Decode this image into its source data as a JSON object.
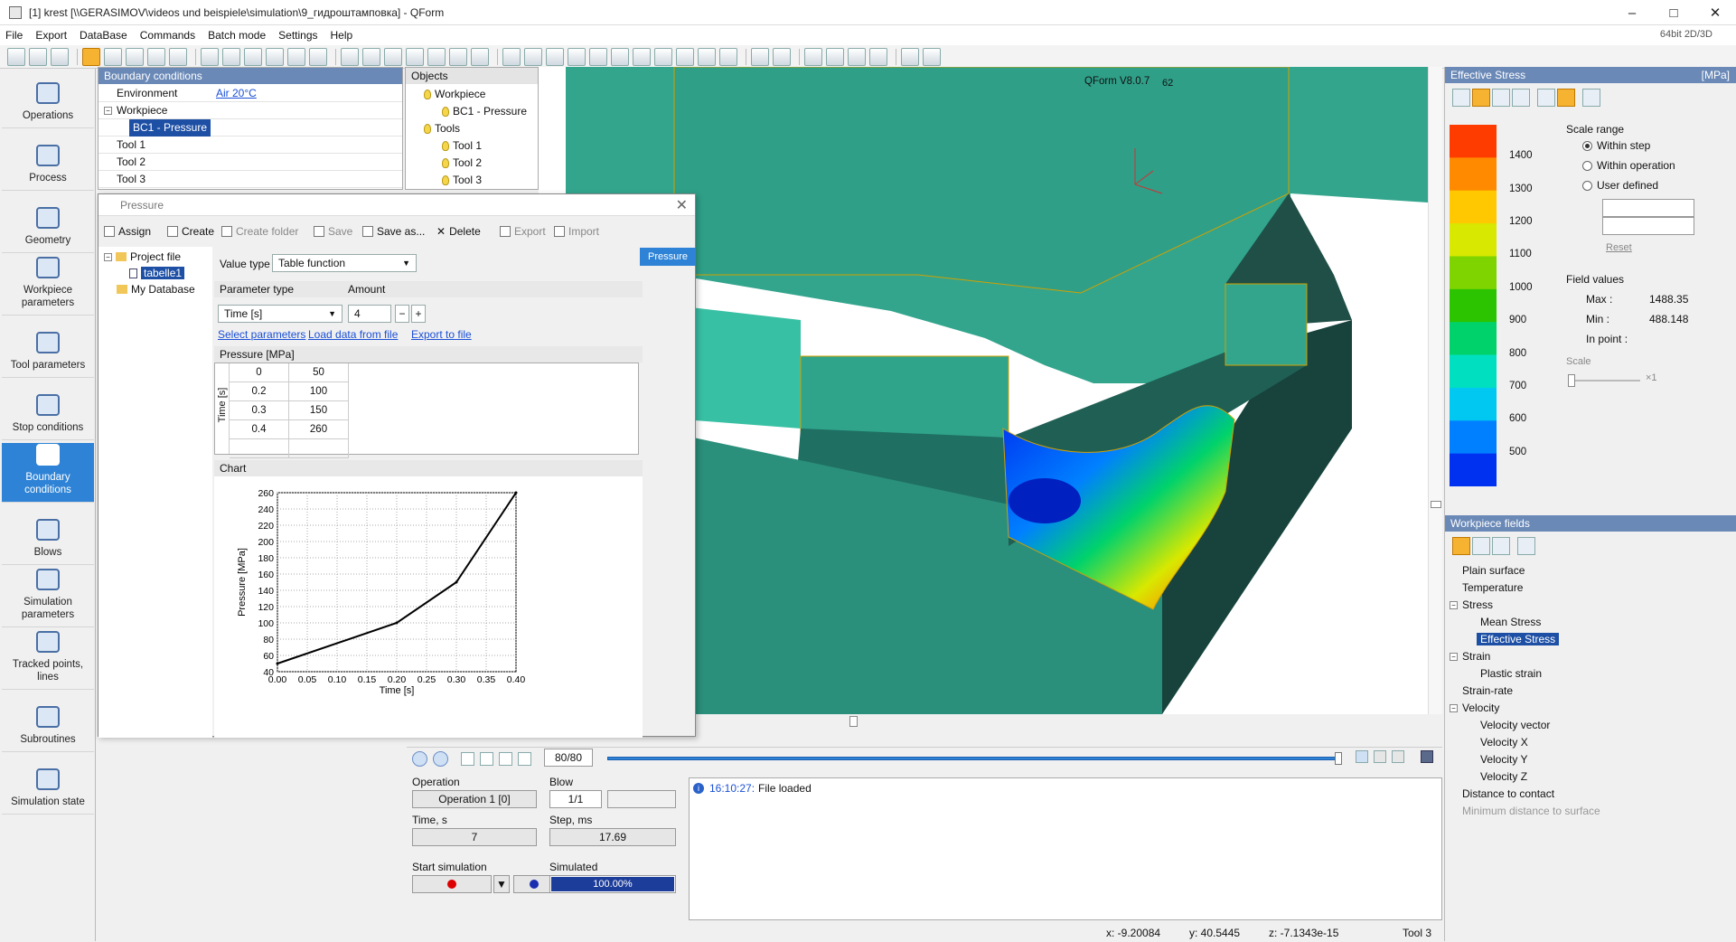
{
  "window": {
    "title": "[1] krest  [\\\\GERASIMOV\\videos und beispiele\\simulation\\9_гидроштамповка] - QForm",
    "bits": "64bit 2D/3D"
  },
  "menu": [
    "File",
    "Export",
    "DataBase",
    "Commands",
    "Batch mode",
    "Settings",
    "Help"
  ],
  "nav": [
    {
      "label": "Operations"
    },
    {
      "label": "Process"
    },
    {
      "label": "Geometry"
    },
    {
      "label": "Workpiece parameters"
    },
    {
      "label": "Tool parameters"
    },
    {
      "label": "Stop conditions"
    },
    {
      "label": "Boundary conditions",
      "active": true
    },
    {
      "label": "Blows"
    },
    {
      "label": "Simulation parameters"
    },
    {
      "label": "Tracked points, lines"
    },
    {
      "label": "Subroutines"
    },
    {
      "label": "Simulation state"
    }
  ],
  "bc": {
    "header": "Boundary conditions",
    "rows": [
      {
        "label": "Environment",
        "value": "Air 20°C"
      },
      {
        "label": "Workpiece",
        "value": ""
      },
      {
        "label": "BC1 - Pressure",
        "value": ""
      },
      {
        "label": "Tool 1",
        "value": ""
      },
      {
        "label": "Tool 2",
        "value": ""
      },
      {
        "label": "Tool 3",
        "value": ""
      }
    ]
  },
  "objects": {
    "header": "Objects",
    "items": [
      "Workpiece",
      "BC1 - Pressure",
      "Tools",
      "Tool 1",
      "Tool 2",
      "Tool 3"
    ]
  },
  "viewport": {
    "version": "QForm V8.0.7",
    "counter": "62"
  },
  "dialog": {
    "title": "Pressure",
    "toolbar": {
      "assign": "Assign",
      "create": "Create",
      "create_folder": "Create folder",
      "save": "Save",
      "save_as": "Save as...",
      "delete": "Delete",
      "export": "Export",
      "import": "Import"
    },
    "tree": {
      "project": "Project file",
      "item": "tabelle1",
      "db": "My Database"
    },
    "value_type_label": "Value type",
    "value_type": "Table function",
    "param_type_label": "Parameter type",
    "amount_label": "Amount",
    "param_type": "Time [s]",
    "amount": "4",
    "links": {
      "select": "Select parameters",
      "load": "Load data from file",
      "export": "Export to file"
    },
    "pressure_section": "Pressure [MPa]",
    "time_axis": "Time [s]",
    "table": [
      {
        "t": "0",
        "p": "50"
      },
      {
        "t": "0.2",
        "p": "100"
      },
      {
        "t": "0.3",
        "p": "150"
      },
      {
        "t": "0.4",
        "p": "260"
      }
    ],
    "chart_section": "Chart",
    "tab": "Pressure"
  },
  "chart_data": {
    "type": "line",
    "x": [
      0,
      0.2,
      0.3,
      0.4
    ],
    "series": [
      {
        "values": [
          50,
          100,
          150,
          260
        ]
      }
    ],
    "xlabel": "Time [s]",
    "ylabel": "Pressure [MPa]",
    "xlim": [
      0,
      0.4
    ],
    "ylim": [
      40,
      260
    ],
    "xticks": [
      "0.00",
      "0.05",
      "0.10",
      "0.15",
      "0.20",
      "0.25",
      "0.30",
      "0.35",
      "0.40"
    ],
    "yticks": [
      "40",
      "60",
      "80",
      "100",
      "120",
      "140",
      "160",
      "180",
      "200",
      "220",
      "240",
      "260"
    ],
    "grid": true
  },
  "playback": {
    "step": "80/80",
    "progress": 1.0
  },
  "info": {
    "operation_label": "Operation",
    "operation": "Operation 1 [0]",
    "blow_label": "Blow",
    "blow": "1/1",
    "time_label": "Time, s",
    "time": "7",
    "step_label": "Step, ms",
    "step": "17.69",
    "start_label": "Start simulation",
    "simulated_label": "Simulated",
    "simulated": "100.00%"
  },
  "log": {
    "time": "16:10:27:",
    "msg": "File loaded"
  },
  "status": {
    "x": "x: -9.20084",
    "y": "y: 40.5445",
    "z": "z: -7.1343e-15",
    "tool": "Tool 3"
  },
  "effective_stress": {
    "header": "Effective Stress",
    "unit": "[MPa]",
    "scale_range": "Scale range",
    "options": [
      "Within step",
      "Within operation",
      "User defined"
    ],
    "reset": "Reset",
    "field_values": "Field values",
    "max_label": "Max :",
    "max": "1488.35",
    "min_label": "Min :",
    "min": "488.148",
    "inpoint_label": "In point :",
    "scale": "Scale",
    "scale_mult": "×1",
    "ticks": [
      "1400",
      "1300",
      "1200",
      "1100",
      "1000",
      "900",
      "800",
      "700",
      "600",
      "500"
    ],
    "colors": [
      "#ff3c00",
      "#ff8a00",
      "#ffc800",
      "#d8e800",
      "#7fd400",
      "#2cc400",
      "#00d26b",
      "#00e0c0",
      "#00c8f0",
      "#0080ff",
      "#0030f0"
    ]
  },
  "workpiece_fields": {
    "header": "Workpiece fields",
    "items": [
      {
        "label": "Plain surface",
        "level": 0
      },
      {
        "label": "Temperature",
        "level": 0
      },
      {
        "label": "Stress",
        "level": 0,
        "group": true
      },
      {
        "label": "Mean Stress",
        "level": 1
      },
      {
        "label": "Effective Stress",
        "level": 1,
        "selected": true
      },
      {
        "label": "Strain",
        "level": 0,
        "group": true
      },
      {
        "label": "Plastic strain",
        "level": 1
      },
      {
        "label": "Strain-rate",
        "level": 0
      },
      {
        "label": "Velocity",
        "level": 0,
        "group": true
      },
      {
        "label": "Velocity vector",
        "level": 1
      },
      {
        "label": "Velocity X",
        "level": 1
      },
      {
        "label": "Velocity Y",
        "level": 1
      },
      {
        "label": "Velocity Z",
        "level": 1
      },
      {
        "label": "Distance to contact",
        "level": 0
      },
      {
        "label": "Minimum distance to surface",
        "level": 0,
        "disabled": true
      }
    ]
  }
}
